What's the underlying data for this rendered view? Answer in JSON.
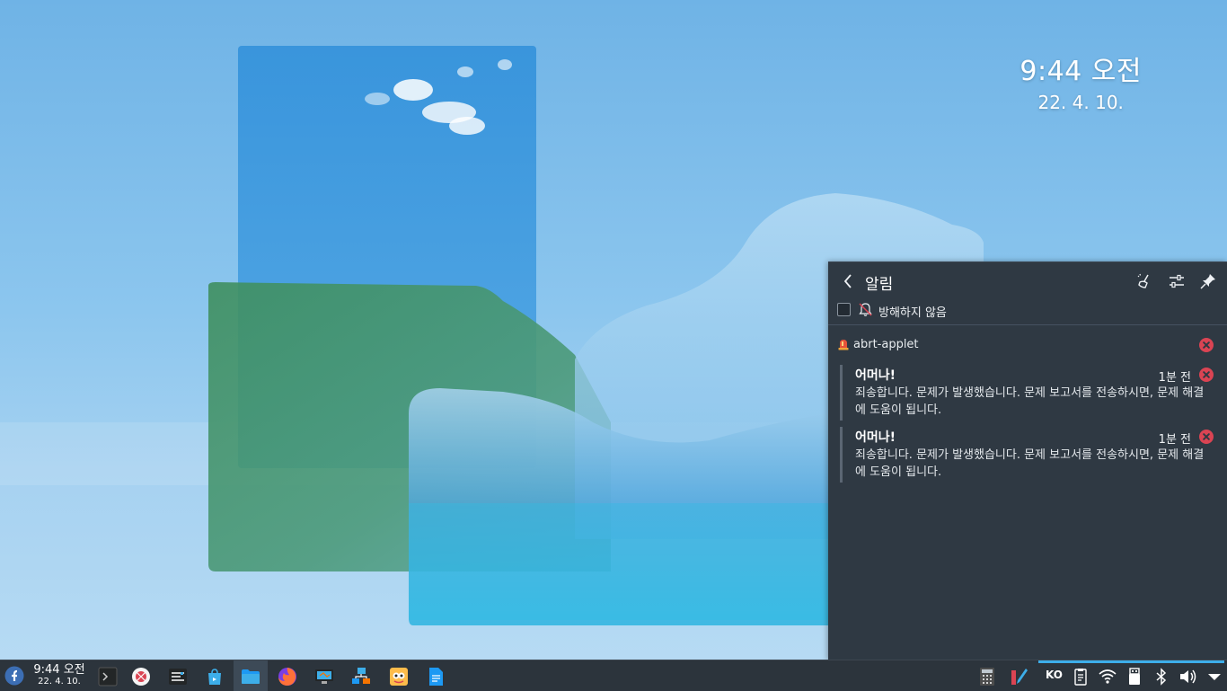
{
  "desktop_clock": {
    "time": "9:44 오전",
    "date": "22. 4. 10."
  },
  "notifications": {
    "title": "알림",
    "dnd_label": "방해하지 않음",
    "group": {
      "app_name": "abrt-applet",
      "items": [
        {
          "title": "어머나!",
          "time": "1분 전",
          "body": "죄송합니다. 문제가 발생했습니다. 문제 보고서를 전송하시면, 문제 해결에 도움이 됩니다."
        },
        {
          "title": "어머나!",
          "time": "1분 전",
          "body": "죄송합니다. 문제가 발생했습니다. 문제 보고서를 전송하시면, 문제 해결에 도움이 됩니다."
        }
      ]
    }
  },
  "taskbar": {
    "clock_time": "9:44 오전",
    "clock_date": "22. 4. 10.",
    "input_method": "KO",
    "tasks": [
      "terminal-icon",
      "bug-report-icon",
      "system-monitor-icon",
      "discover-icon",
      "file-manager-icon",
      "firefox-icon",
      "display-settings-icon",
      "network-icon",
      "screenshot-icon",
      "document-icon"
    ],
    "tray": [
      "calculator-icon",
      "color-picker-icon",
      "keyboard-layout-icon",
      "clipboard-icon",
      "wifi-icon",
      "usb-icon",
      "bluetooth-icon",
      "volume-icon",
      "tray-expand-icon"
    ]
  },
  "colors": {
    "panel_bg": "#2f3943",
    "taskbar_bg": "#2c343c",
    "accent": "#3daee9",
    "close_red": "#da4453"
  }
}
